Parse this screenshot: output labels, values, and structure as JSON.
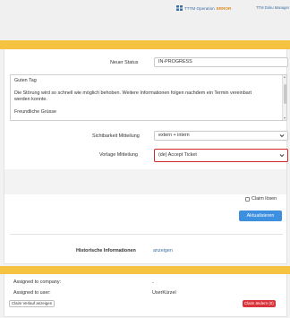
{
  "topbar": {
    "operation_prefix": "TTTM Operation",
    "operation_status": "ERROR",
    "user_label": "TTM Doku Manager"
  },
  "form": {
    "status_label": "Neuer Status",
    "status_value": "IN-PROGRESS",
    "message_lines": [
      "Guten Tag",
      "Die Störung wird so schnell wie möglich behoben. Weitere Informationen folgen nachdem ein Termin vereinbart",
      "werden konnte.",
      "Freundliche Grüsse"
    ],
    "visibility_label": "Sichtbarkeit Mitteilung",
    "visibility_value": "extern + intern",
    "template_label": "Vorlage Mitteilung",
    "template_value": "(de) Accept Ticket",
    "claim_release_label": "Claim lösen",
    "update_button": "Aktualisieren",
    "history_label": "Historische Informationen",
    "history_link": "anzeigen"
  },
  "claim": {
    "company_label": "Assigned to company:",
    "company_value": "-",
    "user_label": "Assigned to user:",
    "user_value": "UserKürzel",
    "history_button": "Claim Verlauf anzeigen",
    "change_button": "Claim ändern (0)"
  },
  "colors": {
    "accent_band": "#f5c242",
    "primary_button": "#3d8fe0",
    "danger_button": "#d9343a",
    "highlight_border": "#d4242e",
    "link": "#3a6ea5",
    "status_error": "#e08a1e"
  },
  "icons": {
    "operation": "grid-icon",
    "select_chevron": "chevron-down-icon"
  }
}
